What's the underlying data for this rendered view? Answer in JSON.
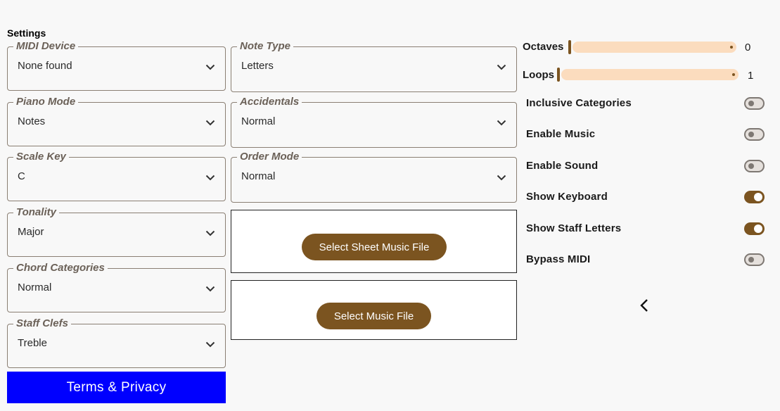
{
  "page": {
    "title": "Settings"
  },
  "left_fields": [
    {
      "label": "MIDI Device",
      "value": "None found"
    },
    {
      "label": "Piano Mode",
      "value": "Notes"
    },
    {
      "label": "Scale Key",
      "value": "C"
    },
    {
      "label": "Tonality",
      "value": "Major"
    },
    {
      "label": "Chord Categories",
      "value": "Normal"
    },
    {
      "label": "Staff Clefs",
      "value": "Treble"
    }
  ],
  "right_fields": [
    {
      "label": "Note Type",
      "value": "Letters"
    },
    {
      "label": "Accidentals",
      "value": "Normal"
    },
    {
      "label": "Order Mode",
      "value": "Normal"
    }
  ],
  "buttons": {
    "sheet_music": "Select Sheet Music File",
    "music_file": "Select Music File",
    "terms": "Terms & Privacy"
  },
  "sliders": {
    "octaves": {
      "label": "Octaves",
      "value": "0"
    },
    "loops": {
      "label": "Loops",
      "value": "1"
    }
  },
  "toggles": [
    {
      "label": "Inclusive Categories",
      "on": false
    },
    {
      "label": "Enable Music",
      "on": false
    },
    {
      "label": "Enable Sound",
      "on": false
    },
    {
      "label": "Show Keyboard",
      "on": true
    },
    {
      "label": "Show Staff Letters",
      "on": true
    },
    {
      "label": "Bypass MIDI",
      "on": false
    }
  ],
  "colors": {
    "accent": "#7b5420",
    "slider_track": "#fbdcbe",
    "terms_button": "#0000ff"
  },
  "icons": {
    "dropdown": "chevron-down-icon",
    "back": "chevron-left-icon"
  }
}
